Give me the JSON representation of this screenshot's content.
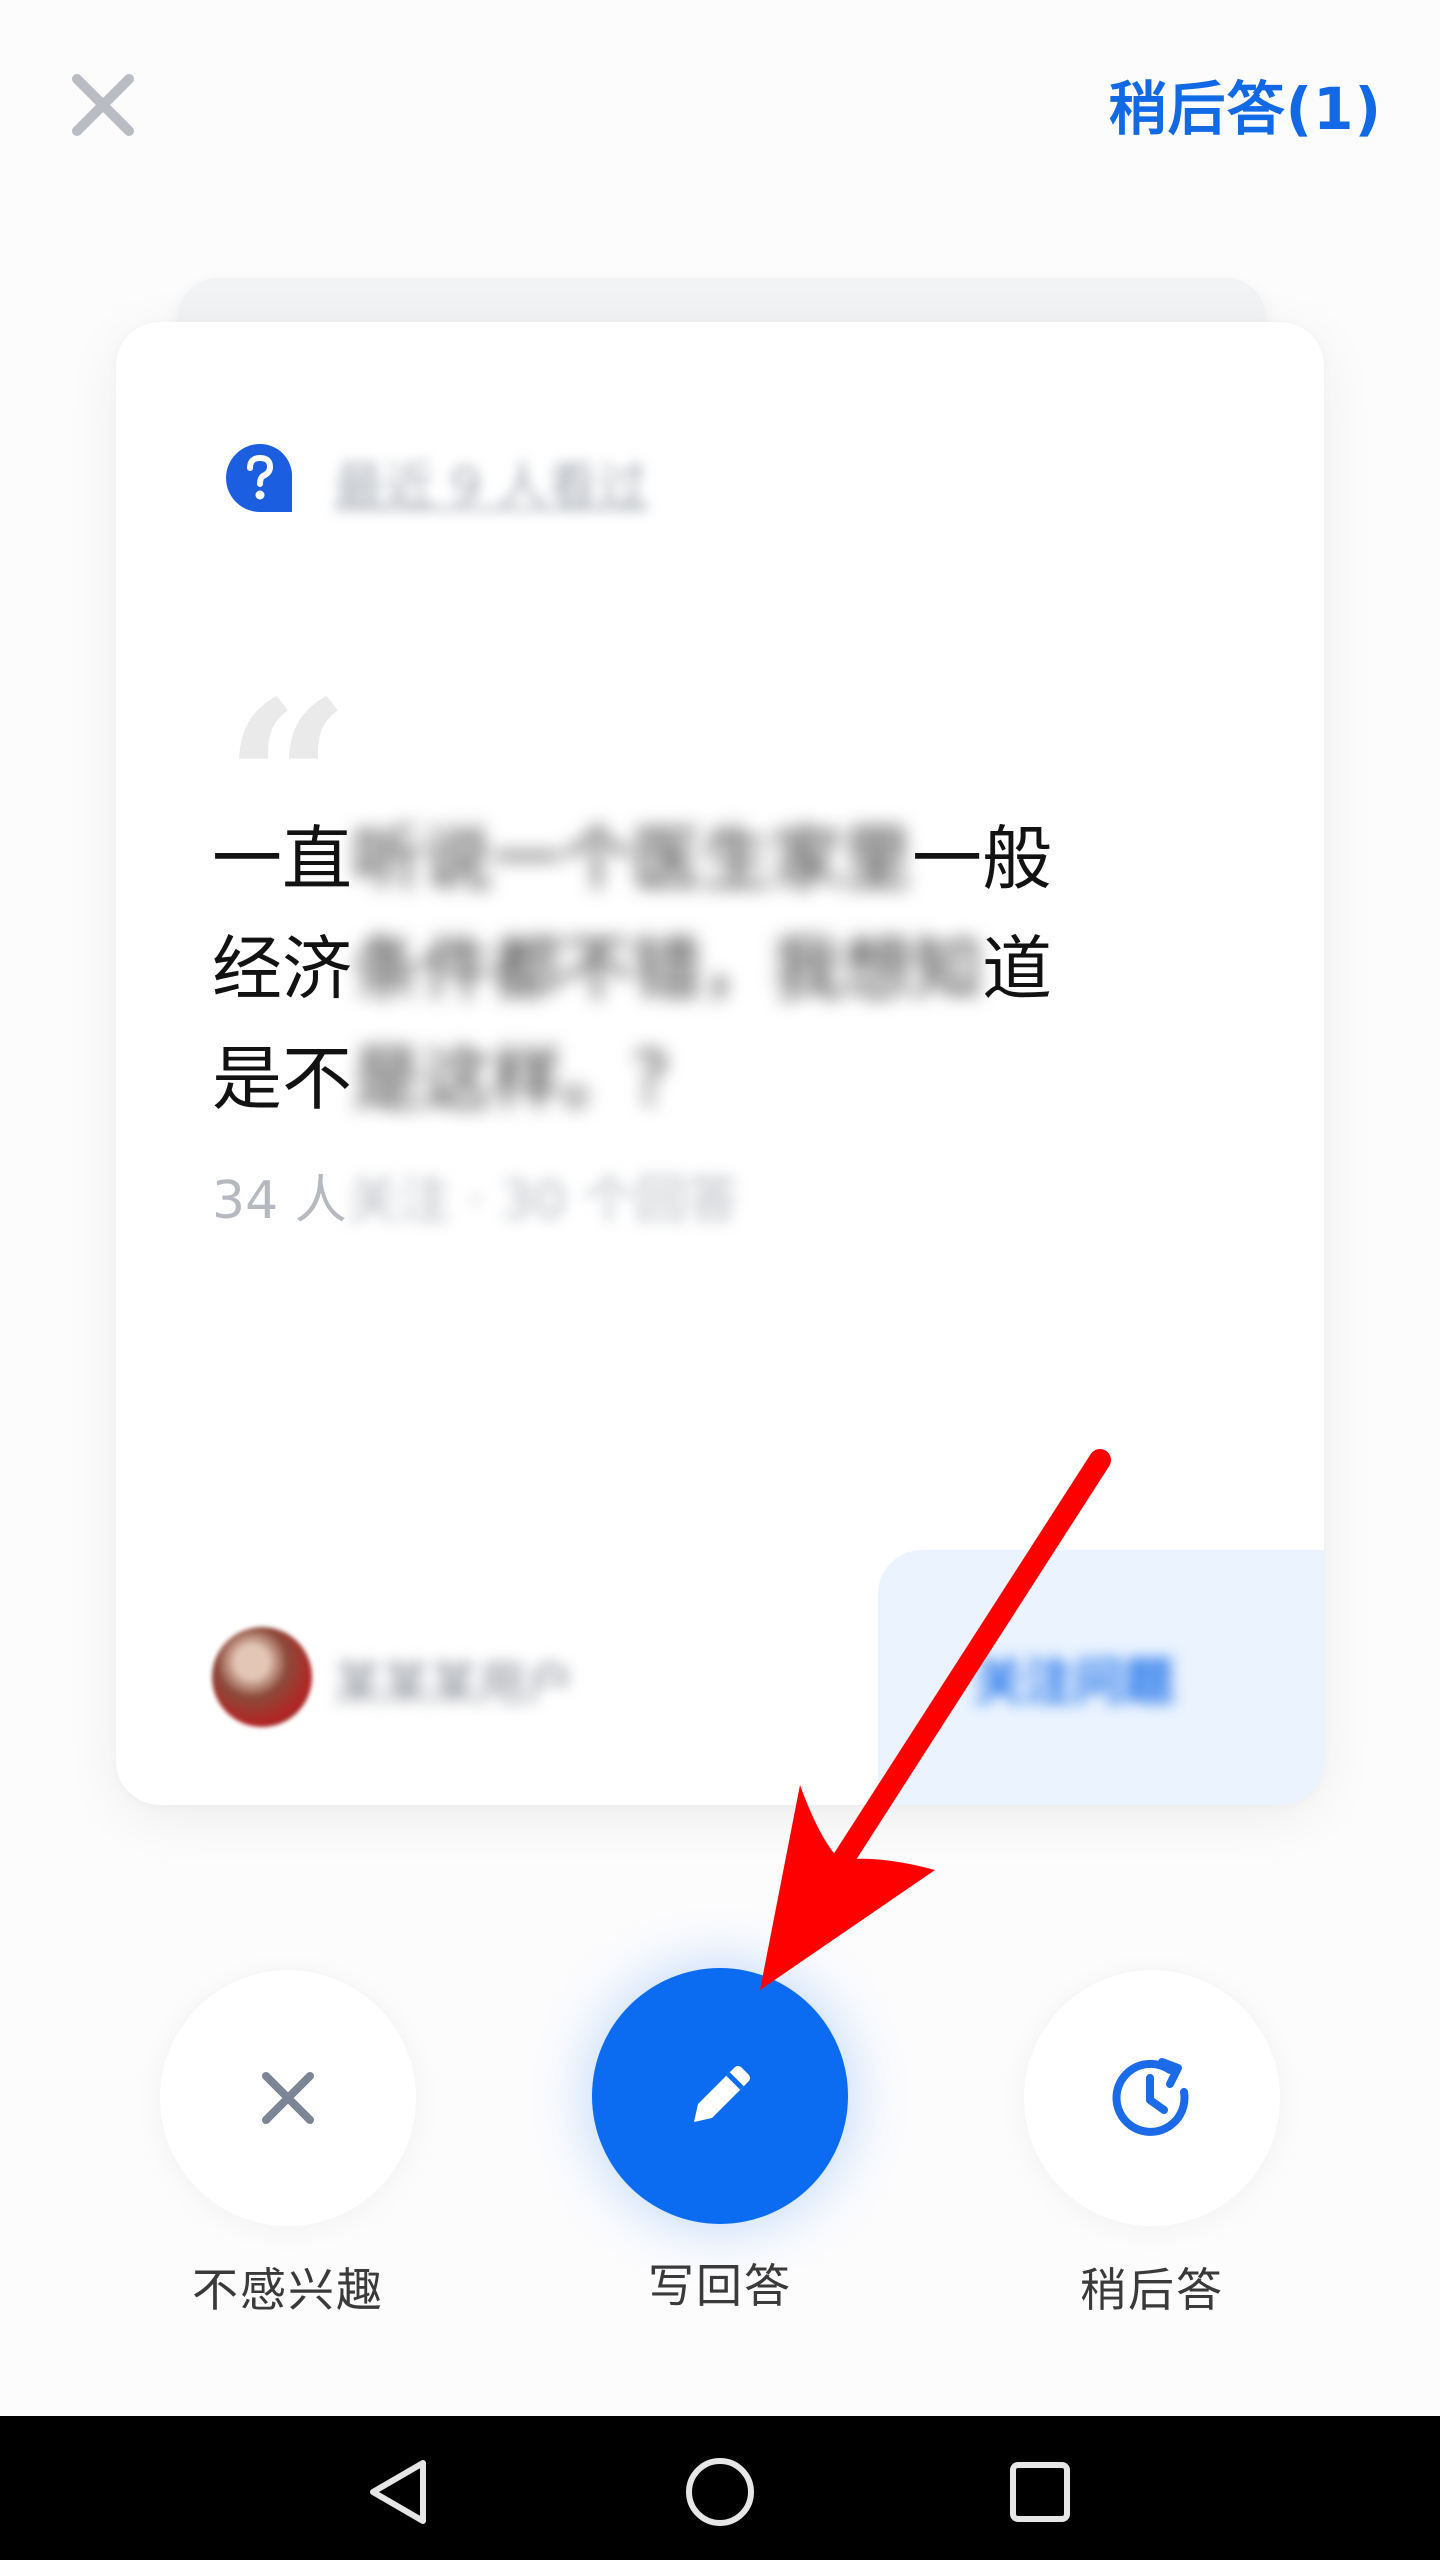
{
  "header": {
    "later_answer_label": "稍后答(1)"
  },
  "card": {
    "recent_activity": "最近 9 人看过",
    "question": {
      "line1_start": "一直",
      "line1_blurred": "听说一个医生家里",
      "line1_end": "一般",
      "line2_start": "经济",
      "line2_blurred": "条件都不错，我想知",
      "line2_end": "道",
      "line3_start": "是不",
      "line3_blurred": "是这样。？",
      "line3_end": ""
    },
    "meta_prefix": "34 人",
    "meta_blurred": "关注 · 30 个回答",
    "author_name": "某某某用户",
    "follow_label": "关注问题"
  },
  "actions": {
    "not_interested": "不感兴趣",
    "write_answer": "写回答",
    "answer_later": "稍后答"
  },
  "colors": {
    "accent": "#0b6cf2",
    "link": "#1269e6",
    "annotation": "#ff0000"
  },
  "icons": {
    "close": "close-icon",
    "question_badge": "question-badge-icon",
    "pencil": "pencil-icon",
    "clock_refresh": "clock-refresh-icon",
    "nav_back": "nav-back-icon",
    "nav_home": "nav-home-icon",
    "nav_recents": "nav-recents-icon"
  }
}
